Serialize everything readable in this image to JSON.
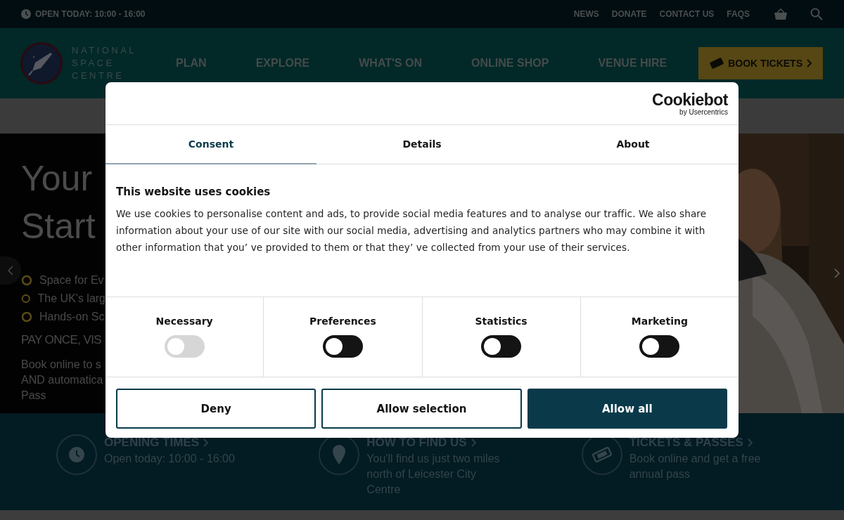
{
  "top_bar": {
    "opening": "OPEN TODAY: 10:00 - 16:00",
    "links": [
      "NEWS",
      "DONATE",
      "CONTACT US",
      "FAQS"
    ]
  },
  "header": {
    "logo_lines": [
      "NATIONAL",
      "SPACE",
      "CENTRE"
    ],
    "nav": [
      "PLAN",
      "EXPLORE",
      "WHAT'S ON",
      "ONLINE SHOP",
      "VENUE HIRE"
    ],
    "cta": "BOOK TICKETS"
  },
  "hero": {
    "title_lines": [
      "Your",
      "Start"
    ],
    "features": [
      "Space for Ev",
      "The UK's larg",
      "Hands-on Sc"
    ],
    "subtitle": "PAY ONCE, VIS",
    "text_lines": [
      "Book online to s",
      "AND automatica",
      "Pass"
    ]
  },
  "info": [
    {
      "kind": "clock",
      "title": "OPENING TIMES",
      "text": "Open today: 10:00 - 16:00"
    },
    {
      "kind": "pin",
      "title": "HOW TO FIND US",
      "text": "You'll find us just two miles north of Leicester City Centre"
    },
    {
      "kind": "ticket",
      "title": "TICKETS & PASSES",
      "text": "Book online and get a free annual pass"
    }
  ],
  "cookie_dialog": {
    "brand": "Cookiebot",
    "brand_sub": "by Usercentrics",
    "tabs": [
      {
        "label": "Consent",
        "selected": true
      },
      {
        "label": "Details",
        "selected": false
      },
      {
        "label": "About",
        "selected": false
      }
    ],
    "heading": "This website uses cookies",
    "body": "We use cookies to personalise content and ads, to provide social media features and to analyse our traffic. We also share information about your use of our site with our social media, advertising and analytics partners who may combine it with other information that you’  ve provided to them or that they’  ve collected from your use of their services.",
    "toggles": [
      {
        "label": "Necessary",
        "checked": false,
        "disabled": true
      },
      {
        "label": "Preferences",
        "checked": false,
        "disabled": false
      },
      {
        "label": "Statistics",
        "checked": false,
        "disabled": false
      },
      {
        "label": "Marketing",
        "checked": false,
        "disabled": false
      }
    ],
    "buttons": [
      {
        "label": "Deny",
        "kind": "outline"
      },
      {
        "label": "Allow selection",
        "kind": "outline"
      },
      {
        "label": "Allow all",
        "kind": "primary"
      }
    ]
  }
}
